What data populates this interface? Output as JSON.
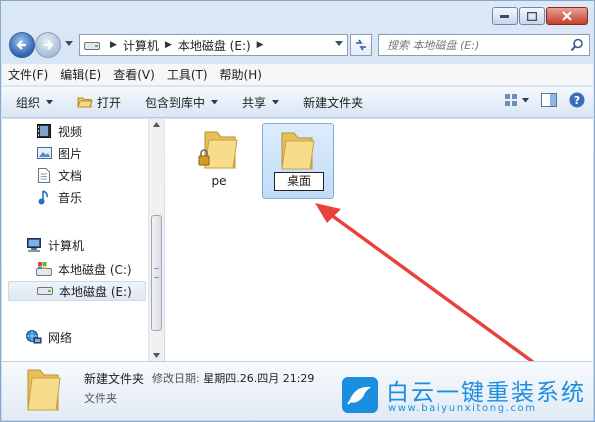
{
  "window": {
    "controls": [
      "minimize-icon",
      "maximize-icon",
      "close-icon"
    ]
  },
  "address": {
    "crumbs": [
      "计算机",
      "本地磁盘 (E:)"
    ]
  },
  "search": {
    "placeholder": "搜索 本地磁盘 (E:)"
  },
  "menu": [
    "文件(F)",
    "编辑(E)",
    "查看(V)",
    "工具(T)",
    "帮助(H)"
  ],
  "toolbar": {
    "organize": "组织",
    "open": "打开",
    "include_in_library": "包含到库中",
    "share": "共享",
    "new_folder": "新建文件夹"
  },
  "sidebar": {
    "items": [
      {
        "label": "视频",
        "icon": "video-icon"
      },
      {
        "label": "图片",
        "icon": "picture-icon"
      },
      {
        "label": "文档",
        "icon": "document-icon"
      },
      {
        "label": "音乐",
        "icon": "music-icon"
      },
      {
        "label": "计算机",
        "icon": "computer-icon"
      },
      {
        "label": "本地磁盘 (C:)",
        "icon": "system-drive-icon"
      },
      {
        "label": "本地磁盘 (E:)",
        "icon": "drive-icon"
      },
      {
        "label": "网络",
        "icon": "network-icon"
      }
    ]
  },
  "files": [
    {
      "name": "pe",
      "icon": "locked-folder-icon"
    },
    {
      "name": "桌面",
      "icon": "folder-icon",
      "renaming": true
    }
  ],
  "details": {
    "name": "新建文件夹",
    "modified_label": "修改日期:",
    "modified_value": "星期四.26.四月 21:29",
    "type": "文件夹"
  },
  "watermark": {
    "title": "白云一键重装系统",
    "url": "www.baiyunxitong.com"
  },
  "colors": {
    "accent": "#1a8fe0",
    "arrow": "#e8423a",
    "selection": "#c1dcf8"
  }
}
